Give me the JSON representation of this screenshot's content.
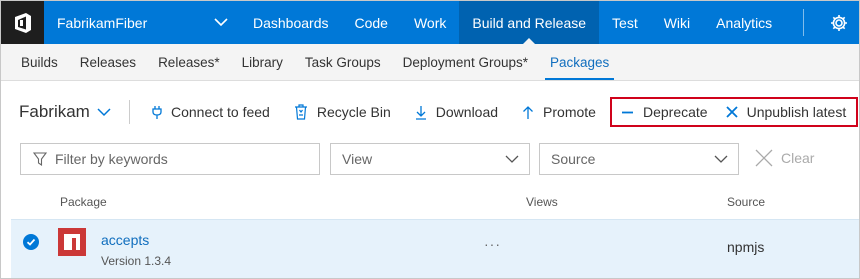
{
  "topbar": {
    "project": "FabrikamFiber",
    "nav": [
      "Dashboards",
      "Code",
      "Work",
      "Build and Release",
      "Test",
      "Wiki",
      "Analytics"
    ],
    "active_nav": "Build and Release"
  },
  "subnav": {
    "items": [
      "Builds",
      "Releases",
      "Releases*",
      "Library",
      "Task Groups",
      "Deployment Groups*",
      "Packages"
    ],
    "active": "Packages"
  },
  "toolbar": {
    "feed": "Fabrikam",
    "connect": "Connect to feed",
    "recycle": "Recycle Bin",
    "download": "Download",
    "promote": "Promote",
    "deprecate": "Deprecate",
    "unpublish": "Unpublish latest"
  },
  "filters": {
    "keywords_placeholder": "Filter by keywords",
    "view": "View",
    "source": "Source",
    "clear": "Clear"
  },
  "table": {
    "headers": {
      "package": "Package",
      "views": "Views",
      "source": "Source"
    },
    "rows": [
      {
        "name": "accepts",
        "version": "Version 1.3.4",
        "views": "···",
        "source": "npmjs"
      }
    ]
  },
  "colors": {
    "brand": "#0078d7",
    "highlight": "#d0021b",
    "npm": "#cb3837"
  }
}
